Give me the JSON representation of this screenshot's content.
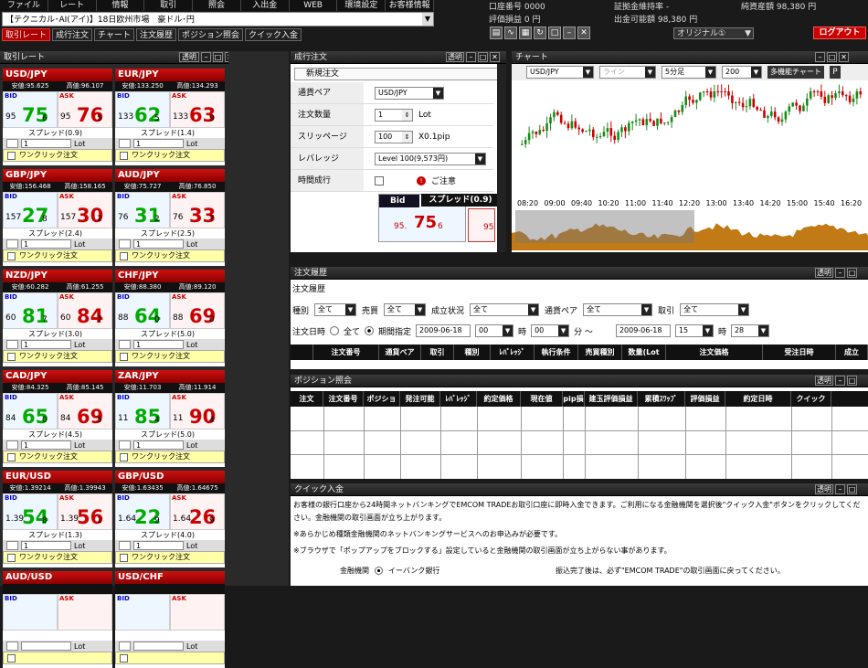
{
  "menu": [
    "ファイル",
    "レート",
    "情報",
    "取引",
    "照会",
    "入出金",
    "WEB",
    "環境設定",
    "お客様情報"
  ],
  "market": "【テクニカル･AI(アイ)】18日欧州市場　豪ドル･円",
  "tabs": [
    "取引レート",
    "成行注文",
    "チャート",
    "注文履歴",
    "ポジション照会",
    "クイック入金"
  ],
  "account": {
    "acct_no": "口座番号 0000",
    "eval": "評価損益 0 円",
    "margin_ratio": "証拠金維持率 -",
    "withdraw": "出金可能額 98,380 円",
    "net": "純資産額 98,380 円"
  },
  "logout": "ログアウト",
  "layout": "オリジナル①",
  "rates_title": "取引レート",
  "panel_ctl": {
    "trans": "透明"
  },
  "rates": [
    {
      "pair": "USD/JPY",
      "low": "安値:95.625",
      "high": "高値:96.107",
      "bp": "95",
      "bb": "75",
      "bs": "6",
      "ap": "95",
      "ab": "76",
      "as": "5",
      "spread": "スプレッド(0.9)",
      "lot": "1",
      "one": "ワンクリック注文"
    },
    {
      "pair": "EUR/JPY",
      "low": "安値:133.250",
      "high": "高値:134.293",
      "bp": "133",
      "bb": "62",
      "bs": "5",
      "ap": "133",
      "ab": "63",
      "as": "9",
      "spread": "スプレッド(1.4)",
      "lot": "1",
      "one": "ワンクリック注文"
    },
    {
      "pair": "GBP/JPY",
      "low": "安値:156.468",
      "high": "高値:158.165",
      "bp": "157",
      "bb": "27",
      "bs": "8",
      "ap": "157",
      "ab": "30",
      "as": "2",
      "spread": "スプレッド(2.4)",
      "lot": "1",
      "one": "ワンクリック注文"
    },
    {
      "pair": "AUD/JPY",
      "low": "安値:75.727",
      "high": "高値:76.850",
      "bp": "76",
      "bb": "31",
      "bs": "2",
      "ap": "76",
      "ab": "33",
      "as": "7",
      "spread": "スプレッド(2.5)",
      "lot": "1",
      "one": "ワンクリック注文"
    },
    {
      "pair": "NZD/JPY",
      "low": "安値:60.282",
      "high": "高値:61.255",
      "bp": "60",
      "bb": "81",
      "bs": "7",
      "ap": "60",
      "ab": "84",
      "as": "7",
      "spread": "スプレッド(3.0)",
      "lot": "1",
      "one": "ワンクリック注文"
    },
    {
      "pair": "CHF/JPY",
      "low": "安値:88.380",
      "high": "高値:89.120",
      "bp": "88",
      "bb": "64",
      "bs": "0",
      "ap": "88",
      "ab": "69",
      "as": "0",
      "spread": "スプレッド(5.0)",
      "lot": "1",
      "one": "ワンクリック注文"
    },
    {
      "pair": "CAD/JPY",
      "low": "安値:84.325",
      "high": "高値:85.145",
      "bp": "84",
      "bb": "65",
      "bs": "0",
      "ap": "84",
      "ab": "69",
      "as": "5",
      "spread": "スプレッド(4.5)",
      "lot": "1",
      "one": "ワンクリック注文"
    },
    {
      "pair": "ZAR/JPY",
      "low": "安値:11.703",
      "high": "高値:11.914",
      "bp": "11",
      "bb": "85",
      "bs": "4",
      "ap": "11",
      "ab": "90",
      "as": "4",
      "spread": "スプレッド(5.0)",
      "lot": "1",
      "one": "ワンクリック注文"
    },
    {
      "pair": "EUR/USD",
      "low": "安値:1.39214",
      "high": "高値:1.39943",
      "bp": "1.39",
      "bb": "54",
      "bs": "8",
      "ap": "1.39",
      "ab": "56",
      "as": "1",
      "spread": "スプレッド(1.3)",
      "lot": "1",
      "one": "ワンクリック注文"
    },
    {
      "pair": "GBP/USD",
      "low": "安値:1.63435",
      "high": "高値:1.64675",
      "bp": "1.64",
      "bb": "22",
      "bs": "9",
      "ap": "1.64",
      "ab": "26",
      "as": "9",
      "spread": "スプレッド(4.0)",
      "lot": "1",
      "one": "ワンクリック注文"
    },
    {
      "pair": "AUD/USD",
      "low": "",
      "high": "",
      "bp": "",
      "bb": "",
      "bs": "",
      "ap": "",
      "ab": "",
      "as": "",
      "spread": "",
      "lot": "",
      "one": ""
    },
    {
      "pair": "USD/CHF",
      "low": "",
      "high": "",
      "bp": "",
      "bb": "",
      "bs": "",
      "ap": "",
      "ab": "",
      "as": "",
      "spread": "",
      "lot": "",
      "one": ""
    }
  ],
  "order": {
    "title": "成行注文",
    "sub": "新規注文",
    "pair_k": "通貨ペア",
    "pair_v": "USD/JPY",
    "qty_k": "注文数量",
    "qty_v": "1",
    "qty_u": "Lot",
    "slip_k": "スリッページ",
    "slip_v": "100",
    "slip_u": "X0.1pip",
    "lev_k": "レバレッジ",
    "lev_v": "Level 100(9,573円)",
    "time_k": "時間成行",
    "caution": "ご注意",
    "bid": "Bid",
    "spread": "スプレッド(0.9)",
    "bid_pre": "95.",
    "bid_big": "75",
    "bid_sub": "6",
    "ask_pre": "95"
  },
  "chart": {
    "title": "チャート",
    "pair": "USD/JPY",
    "line": "ライン",
    "period": "5分足",
    "count": "200",
    "multi": "多機能チャート",
    "times": [
      "08:20",
      "09:00",
      "09:40",
      "10:20",
      "11:00",
      "11:40",
      "12:20",
      "13:00",
      "13:40",
      "14:20",
      "15:00",
      "15:40",
      "16:20"
    ]
  },
  "chart_data": {
    "type": "candlestick",
    "x": [
      "08:20",
      "09:00",
      "09:40",
      "10:20",
      "11:00",
      "11:40",
      "12:20",
      "13:00",
      "13:40",
      "14:20",
      "15:00",
      "15:40",
      "16:20"
    ]
  },
  "hist": {
    "title": "注文履歴",
    "sub": "注文履歴",
    "f_kind": "種別",
    "f_kind_v": "全て",
    "f_side": "売買",
    "f_side_v": "全て",
    "f_status": "成立状況",
    "f_status_v": "全て",
    "f_pair": "通貨ペア",
    "f_pair_v": "全て",
    "f_trade": "取引",
    "f_trade_v": "全て",
    "f_date": "注文日時",
    "r_all": "全て",
    "r_period": "期間指定",
    "d1": "2009-06-18",
    "h1": "00",
    "hu": "時",
    "m1": "00",
    "mu": "分 ～",
    "d2": "2009-06-18",
    "h2": "15",
    "m2": "28",
    "cols": [
      "注文番号",
      "通貨ペア",
      "取引",
      "種別",
      "ﾚﾊﾞﾚｯｼﾞ",
      "執行条件",
      "売買種別",
      "数量(Lot",
      "注文価格",
      "受注日時",
      "成立"
    ]
  },
  "pos": {
    "title": "ポジション照会",
    "cols": [
      "注文",
      "注文番号",
      "ポジション",
      "発注可能",
      "ﾚﾊﾞﾚｯｼﾞ",
      "約定価格",
      "現在値",
      "pip損",
      "建玉評価損益",
      "累積ｽﾜｯﾌﾟ",
      "評価損益",
      "約定日時",
      "クイック"
    ]
  },
  "quick": {
    "title": "クイック入金",
    "p1": "お客様の銀行口座から24時間ネットバンキングでEMCOM TRADEお取引口座に即時入金できます。ご利用になる金融機関を選択後\"クイック入金\"ボタンをクリックしてください。金融機関の取引画面が立ち上がります。",
    "p2": "※あらかじめ種類金融機関のネットバンキングサービスへのお申込みが必要です。",
    "p3": "※ブラウザで「ポップアップをブロックする」設定していると金融機関の取引画面が立ち上がらない事があります。",
    "bank_k": "金融機関",
    "bank_v": "イーバンク銀行",
    "p4": "振込完了後は、必ず\"EMCOM TRADE\"の取引画面に戻ってください。"
  }
}
